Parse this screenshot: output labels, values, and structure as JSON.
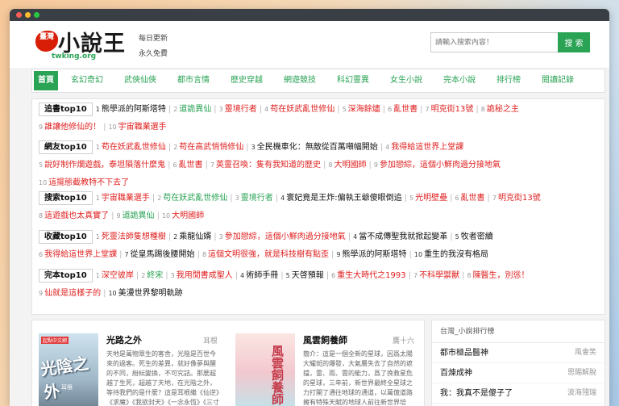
{
  "brand": {
    "badge": "臺灣",
    "name": "小說王",
    "domain": "twking.org",
    "slogan1": "每日更新",
    "slogan2": "永久免費"
  },
  "search": {
    "placeholder": "請輸入搜索內容！",
    "button": "搜 索"
  },
  "nav": [
    "首頁",
    "玄幻奇幻",
    "武俠仙俠",
    "都市言情",
    "歷史穿越",
    "網遊競技",
    "科幻靈異",
    "女生小說",
    "完本小說",
    "排行榜",
    "閱讀記錄"
  ],
  "ranks": [
    {
      "title": "追書top10",
      "line1": [
        {
          "n": "1",
          "t": "熊學派的阿斯塔特",
          "c": "dark"
        },
        {
          "n": "2",
          "t": "道詭異仙",
          "c": "green"
        },
        {
          "n": "3",
          "t": "靈境行者",
          "c": "red"
        },
        {
          "n": "4",
          "t": "苟在妖武亂世修仙",
          "c": "red"
        },
        {
          "n": "5",
          "t": "深海餘燼",
          "c": "red"
        },
        {
          "n": "6",
          "t": "亂世書",
          "c": "red"
        },
        {
          "n": "7",
          "t": "明克街13號",
          "c": "red"
        },
        {
          "n": "8",
          "t": "詭秘之主",
          "c": "red"
        }
      ],
      "line2": [
        {
          "n": "9",
          "t": "誰讓他修仙的！",
          "c": "red"
        },
        {
          "n": "10",
          "t": "宇宙職業選手",
          "c": "red"
        }
      ]
    },
    {
      "title": "網友top10",
      "line1": [
        {
          "n": "1",
          "t": "苟在妖武亂世修仙",
          "c": "red"
        },
        {
          "n": "2",
          "t": "苟在高武悄悄修仙",
          "c": "red"
        },
        {
          "n": "3",
          "t": "全民機車化：無敵從百萬噸幅開始",
          "c": "dark"
        },
        {
          "n": "4",
          "t": "我得給這世界上堂課",
          "c": "red"
        }
      ],
      "line2": [
        {
          "n": "5",
          "t": "說好制作爛遊戲，泰坦隕落什麼鬼",
          "c": "red"
        },
        {
          "n": "6",
          "t": "亂世書",
          "c": "red"
        },
        {
          "n": "7",
          "t": "英靈召喚：隻有我知道的歷史",
          "c": "red"
        },
        {
          "n": "8",
          "t": "大明國師",
          "c": "red"
        },
        {
          "n": "9",
          "t": "參加戀綜，這個小鮮肉過分接地氣",
          "c": "red"
        }
      ],
      "line3": [
        {
          "n": "10",
          "t": "這擺態截教特不下去了",
          "c": "red"
        }
      ]
    },
    {
      "title": "搜索top10",
      "line1": [
        {
          "n": "1",
          "t": "宇宙職業選手",
          "c": "red"
        },
        {
          "n": "2",
          "t": "苟在妖武亂世修仙",
          "c": "green"
        },
        {
          "n": "3",
          "t": "靈境行者",
          "c": "green"
        },
        {
          "n": "4",
          "t": "寰妃竟是王炸:偏執王爺傻眼倒追",
          "c": "dark"
        },
        {
          "n": "5",
          "t": "光明壁壘",
          "c": "red"
        },
        {
          "n": "6",
          "t": "亂世書",
          "c": "red"
        },
        {
          "n": "7",
          "t": "明克街13號",
          "c": "red"
        }
      ],
      "line2": [
        {
          "n": "8",
          "t": "這遊戲也太真實了",
          "c": "red"
        },
        {
          "n": "9",
          "t": "道詭異仙",
          "c": "green"
        },
        {
          "n": "10",
          "t": "大明國師",
          "c": "red"
        }
      ]
    },
    {
      "title": "收藏top10",
      "line1": [
        {
          "n": "1",
          "t": "死靈法師隻想種樹",
          "c": "red"
        },
        {
          "n": "2",
          "t": "乘龍仙婿",
          "c": "dark"
        },
        {
          "n": "3",
          "t": "參加戀綜，這個小鮮肉過分接地氣",
          "c": "red"
        },
        {
          "n": "4",
          "t": "當不成傳聖我就掀起變革",
          "c": "dark"
        },
        {
          "n": "5",
          "t": "牧者密續",
          "c": "dark"
        }
      ],
      "line2": [
        {
          "n": "6",
          "t": "我得給這世界上堂課",
          "c": "red"
        },
        {
          "n": "7",
          "t": "從皇馬踢後腰開始",
          "c": "dark"
        },
        {
          "n": "8",
          "t": "這個文明很強，就是科技樹有點歪",
          "c": "red"
        },
        {
          "n": "9",
          "t": "熊學派的阿斯塔特",
          "c": "dark"
        },
        {
          "n": "10",
          "t": "重生的我沒有格局",
          "c": "dark"
        }
      ]
    },
    {
      "title": "完本top10",
      "line1": [
        {
          "n": "1",
          "t": "深空彼岸",
          "c": "red"
        },
        {
          "n": "2",
          "t": "終宋",
          "c": "green"
        },
        {
          "n": "3",
          "t": "我用閒書成聖人",
          "c": "red"
        },
        {
          "n": "4",
          "t": "術師手冊",
          "c": "dark"
        },
        {
          "n": "5",
          "t": "天啓預報",
          "c": "dark"
        },
        {
          "n": "6",
          "t": "重生大時代之1993",
          "c": "red"
        },
        {
          "n": "7",
          "t": "不科學禦獸",
          "c": "red"
        },
        {
          "n": "8",
          "t": "陳醫生，別慫！",
          "c": "red"
        }
      ],
      "line2": [
        {
          "n": "9",
          "t": "仙就是這樣子的",
          "c": "red"
        },
        {
          "n": "10",
          "t": "美漫世界黎明軌跡",
          "c": "dark"
        }
      ]
    }
  ],
  "books": [
    {
      "title": "光路之外",
      "author": "耳根",
      "cover_text": "光陰之外",
      "cover_sub": "耳根",
      "cover_badge": "起點中文網",
      "desc": "天地是萬物眾生的客舍，光陰是百世今來的過客。死生的差異，就好像夢與醒的不同，紛紜變換，不可究詰。那麼超越了生死，超越了天地，在光陰之外，等待我們的是什麼？這是耳根繼《仙逆》《求魔》《我欲封天》《一念永恆》《三寸人間》後，"
    },
    {
      "title": "風雲飼養師",
      "author": "鷹十六",
      "cover_text": "風雲飼養師",
      "desc": "簡介：這是一個全新的星球，因爲太陽大耀斑的爆發，大氣層失去了自然的遮擋，雷、雨、雲的能力，爲了挽救星危的星球，三年前，新世界最終全星球之力打開了通往地球的通道，以萬億道路擁有特殊天賦的地球人前往新世界培"
    }
  ],
  "sidebar": {
    "title": "台灣_小說排行榜",
    "items": [
      {
        "name": "都市極品醫神",
        "author": "風會笑"
      },
      {
        "name": "百煉成神",
        "author": "恩賜解脫"
      },
      {
        "name": "我：我真不是傻子了",
        "author": "波海殘瑞"
      }
    ]
  },
  "colors": {
    "accent": "#2aa355",
    "red": "#e02020"
  }
}
